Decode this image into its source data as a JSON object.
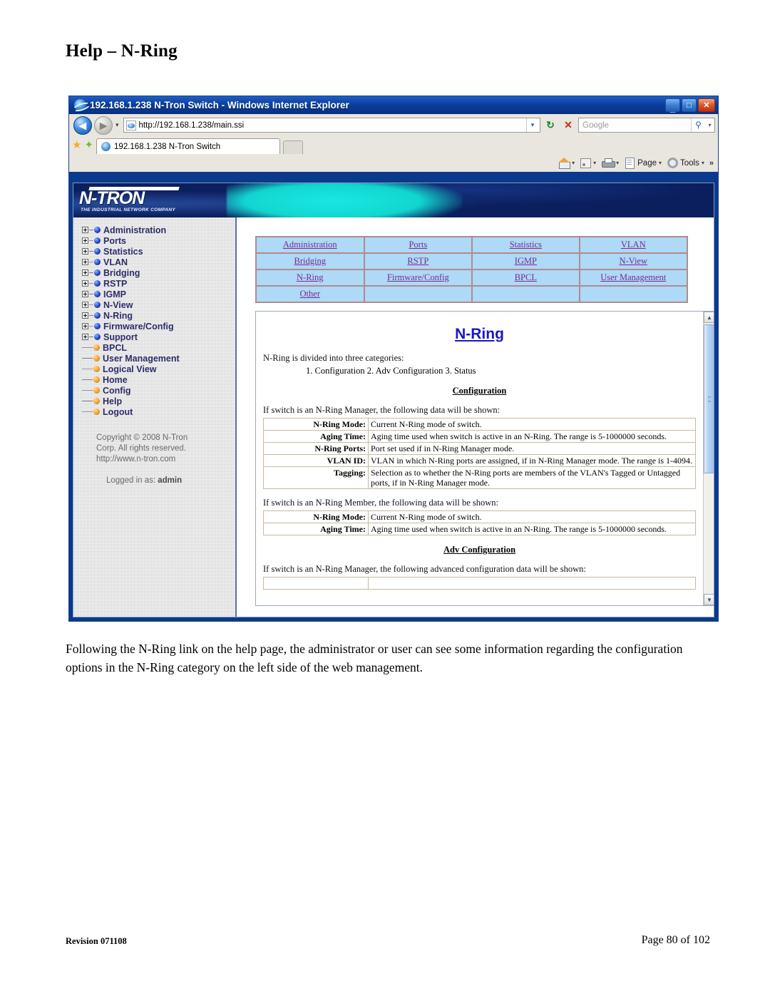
{
  "document": {
    "heading": "Help – N-Ring",
    "caption": "Following the N-Ring link on the help page, the administrator or user can see some information regarding the configuration options in the N-Ring category on the left side of the web management.",
    "footer": {
      "revision": "Revision 071108",
      "page": "Page 80 of 102"
    }
  },
  "browser": {
    "title": "192.168.1.238 N-Tron Switch - Windows Internet Explorer",
    "window_controls": {
      "minimize": "_",
      "maximize": "□",
      "close": "✕"
    },
    "nav": {
      "back": "◀",
      "forward": "▶",
      "history_chevron": "▾",
      "refresh": "↻",
      "stop": "✕"
    },
    "address": {
      "url": "http://192.168.1.238/main.ssi",
      "dropdown": "▾"
    },
    "search": {
      "placeholder": "Google",
      "magnifier": "⚲",
      "dropdown": "▾"
    },
    "tab": {
      "label": "192.168.1.238 N-Tron Switch"
    },
    "commands": [
      {
        "label": "",
        "icon": "home-icon",
        "caret": "▾"
      },
      {
        "label": "",
        "icon": "rss-icon",
        "caret": "▾"
      },
      {
        "label": "",
        "icon": "print-icon",
        "caret": "▾"
      },
      {
        "label": "Page",
        "icon": "page-icon",
        "caret": "▾"
      },
      {
        "label": "Tools",
        "icon": "tools-icon",
        "caret": "▾"
      }
    ],
    "overflow": "»"
  },
  "webpage": {
    "logo": {
      "word": "N-TRON",
      "tagline": "THE INDUSTRIAL NETWORK COMPANY"
    },
    "sidebar": {
      "tree": [
        {
          "label": "Administration",
          "bullet": "blue",
          "expandable": true
        },
        {
          "label": "Ports",
          "bullet": "blue",
          "expandable": true
        },
        {
          "label": "Statistics",
          "bullet": "blue",
          "expandable": true
        },
        {
          "label": "VLAN",
          "bullet": "blue",
          "expandable": true
        },
        {
          "label": "Bridging",
          "bullet": "blue",
          "expandable": true
        },
        {
          "label": "RSTP",
          "bullet": "blue",
          "expandable": true
        },
        {
          "label": "IGMP",
          "bullet": "blue",
          "expandable": true
        },
        {
          "label": "N-View",
          "bullet": "blue",
          "expandable": true
        },
        {
          "label": "N-Ring",
          "bullet": "blue",
          "expandable": true
        },
        {
          "label": "Firmware/Config",
          "bullet": "blue",
          "expandable": true
        },
        {
          "label": "Support",
          "bullet": "blue",
          "expandable": true
        },
        {
          "label": "BPCL",
          "bullet": "orange",
          "expandable": false
        },
        {
          "label": "User Management",
          "bullet": "orange",
          "expandable": false
        },
        {
          "label": "Logical View",
          "bullet": "orange",
          "expandable": false
        },
        {
          "label": "Home",
          "bullet": "orange",
          "expandable": false
        },
        {
          "label": "Config",
          "bullet": "orange",
          "expandable": false
        },
        {
          "label": "Help",
          "bullet": "orange",
          "expandable": false
        },
        {
          "label": "Logout",
          "bullet": "orange",
          "expandable": false
        }
      ],
      "copyright_line1": "Copyright © 2008 N-Tron",
      "copyright_line2": "Corp. All rights reserved.",
      "copyright_line3": "http://www.n-tron.com",
      "logged_in_prefix": "Logged in as:",
      "logged_in_user": "admin"
    },
    "link_table": {
      "rows": [
        [
          "Administration",
          "Ports",
          "Statistics",
          "VLAN"
        ],
        [
          "Bridging",
          "RSTP",
          "IGMP",
          "N-View"
        ],
        [
          "N-Ring",
          "Firmware/Config",
          "BPCL",
          "User Management"
        ],
        [
          "Other",
          "",
          "",
          ""
        ]
      ]
    },
    "help": {
      "title": "N-Ring",
      "intro": "N-Ring is divided into three categories:",
      "categories": "1. Configuration   2. Adv Configuration   3. Status",
      "config_heading": "Configuration",
      "manager_intro": "If switch is an N-Ring Manager, the following data will be shown:",
      "manager_rows": [
        {
          "key": "N-Ring Mode:",
          "value": "Current N-Ring mode of switch."
        },
        {
          "key": "Aging Time:",
          "value": "Aging time used when switch is active in an N-Ring. The range is 5-1000000 seconds."
        },
        {
          "key": "N-Ring Ports:",
          "value": "Port set used if in N-Ring Manager mode."
        },
        {
          "key": "VLAN ID:",
          "value": "VLAN in which N-Ring ports are assigned, if in N-Ring Manager mode. The range is 1-4094."
        },
        {
          "key": "Tagging:",
          "value": "Selection as to whether the N-Ring ports are members of the VLAN's Tagged or Untagged ports, if in N-Ring Manager mode."
        }
      ],
      "member_intro": "If switch is an N-Ring Member, the following data will be shown:",
      "member_rows": [
        {
          "key": "N-Ring Mode:",
          "value": "Current N-Ring mode of switch."
        },
        {
          "key": "Aging Time:",
          "value": "Aging time used when switch is active in an N-Ring. The range is 5-1000000 seconds."
        }
      ],
      "adv_heading": "Adv Configuration",
      "adv_intro": "If switch is an N-Ring Manager, the following advanced configuration data will be shown:"
    },
    "scrollbar": {
      "up": "▲",
      "down": "▼"
    }
  }
}
